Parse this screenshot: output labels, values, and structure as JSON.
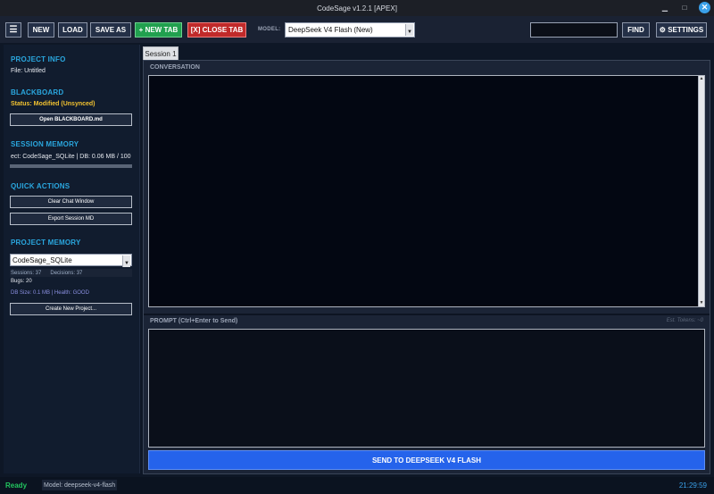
{
  "window": {
    "title": "CodeSage v1.2.1 [APEX]",
    "minimize_glyph": "▁",
    "maximize_glyph": "□",
    "close_glyph": "✕"
  },
  "toolbar": {
    "menu_glyph": "☰",
    "new_label": "NEW",
    "load_label": "LOAD",
    "save_as_label": "SAVE AS",
    "new_tab_label": "+ NEW TAB",
    "close_tab_label": "[X] CLOSE TAB",
    "model_label": "MODEL:",
    "model_value": "DeepSeek V4 Flash (New)",
    "search_value": "",
    "find_label": "FIND",
    "settings_label": "⚙ SETTINGS"
  },
  "sidebar": {
    "project_info_heading": "PROJECT INFO",
    "file_text": "File: Untitled",
    "blackboard_heading": "BLACKBOARD",
    "blackboard_status": "Status: Modified (Unsynced)",
    "open_blackboard_label": "Open BLACKBOARD.md",
    "session_memory_heading": "SESSION MEMORY",
    "session_memory_text": "ect: CodeSage_SQLite | DB: 0.06 MB / 100",
    "quick_actions_heading": "QUICK ACTIONS",
    "clear_chat_label": "Clear Chat Window",
    "export_session_label": "Export Session MD",
    "project_memory_heading": "PROJECT MEMORY",
    "project_select_value": "CodeSage_SQLite",
    "sessions_text": "Sessions: 37",
    "decisions_text": "Decisions: 37",
    "bugs_text": "Bugs: 20",
    "db_health_text": "DB Size: 0.1 MB | Health: GOOD",
    "create_project_label": "Create New Project..."
  },
  "main": {
    "tab_label": "Session 1",
    "conversation_label": "CONVERSATION",
    "prompt_label": "PROMPT (Ctrl+Enter to Send)",
    "tokens_text": "Est. Tokens: ~0",
    "prompt_value": "",
    "send_label": "SEND TO DEEPSEEK V4 FLASH"
  },
  "statusbar": {
    "ready_text": "Ready",
    "model_text": "Model: deepseek-v4-flash",
    "time_text": "21:29:59"
  },
  "colors": {
    "accent_blue": "#2aa7df",
    "status_yellow": "#f2c230",
    "new_tab_green": "#21a04f",
    "close_tab_red": "#c02a2a",
    "send_blue": "#2563eb",
    "ready_green": "#22c55e"
  }
}
